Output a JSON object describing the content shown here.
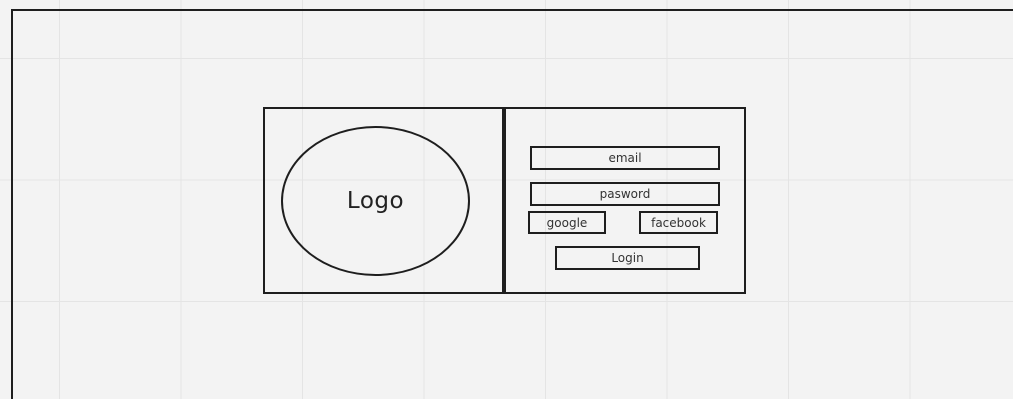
{
  "logo": {
    "label": "Logo"
  },
  "form": {
    "email_label": "email",
    "password_label": "pasword",
    "google_label": "google",
    "facebook_label": "facebook",
    "login_label": "Login"
  },
  "colors": {
    "stroke": "#1e1e1e",
    "background": "#f3f3f3",
    "grid": "#e4e4e4"
  }
}
